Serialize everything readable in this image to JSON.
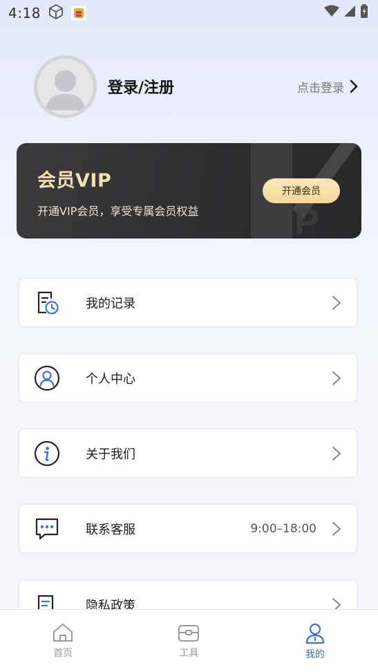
{
  "status": {
    "time": "4:18"
  },
  "profile": {
    "title": "登录/注册",
    "login_link": "点击登录"
  },
  "vip": {
    "title": "会员VIP",
    "subtitle": "开通VIP会员，享受专属会员权益",
    "button": "开通会员",
    "deco_text": "VIP"
  },
  "menu": [
    {
      "label": "我的记录",
      "icon": "record-clock-icon"
    },
    {
      "label": "个人中心",
      "icon": "user-circle-icon"
    },
    {
      "label": "关于我们",
      "icon": "info-circle-icon"
    },
    {
      "label": "联系客服",
      "icon": "chat-bubble-icon",
      "extra": "9:00–18:00"
    },
    {
      "label": "隐私政策",
      "icon": "document-icon"
    }
  ],
  "nav": [
    {
      "label": "首页",
      "icon": "home-icon",
      "active": false
    },
    {
      "label": "工具",
      "icon": "toolbox-icon",
      "active": false
    },
    {
      "label": "我的",
      "icon": "person-icon",
      "active": true
    }
  ],
  "colors": {
    "accent": "#3f6fd8",
    "inactive": "#9a9a9a",
    "vip_gold": "#f6dfb1"
  }
}
